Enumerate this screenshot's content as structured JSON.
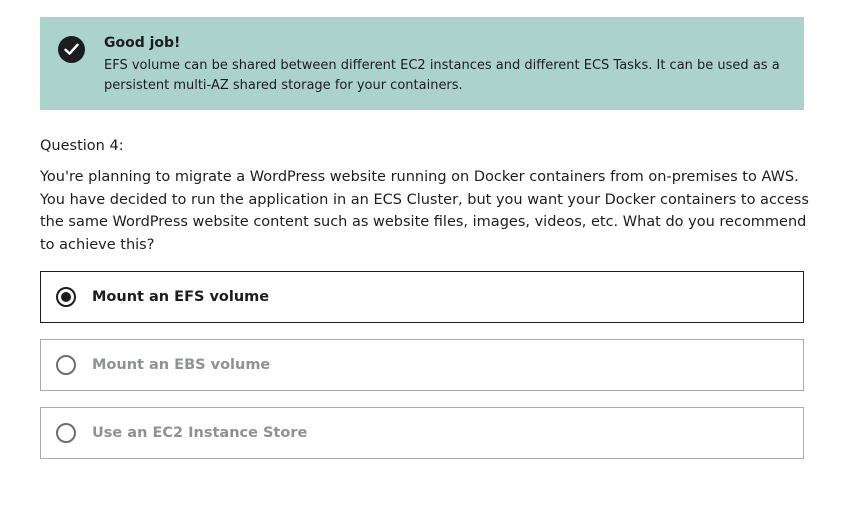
{
  "feedback": {
    "icon": "check-icon",
    "title": "Good job!",
    "message": "EFS volume can be shared between different EC2 instances and different ECS Tasks. It can be used as a persistent multi-AZ shared storage for your containers.",
    "background_color": "#acd2cc"
  },
  "question": {
    "label": "Question 4:",
    "text": "You're planning to migrate a WordPress website running on Docker containers from on-premises to AWS. You have decided to run the application in an ECS Cluster, but you want your Docker containers to access the same WordPress website content such as website files, images, videos, etc. What do you recommend to achieve this?"
  },
  "options": [
    {
      "label": "Mount an EFS volume",
      "selected": true
    },
    {
      "label": "Mount an EBS volume",
      "selected": false
    },
    {
      "label": "Use an EC2 Instance Store",
      "selected": false
    }
  ]
}
